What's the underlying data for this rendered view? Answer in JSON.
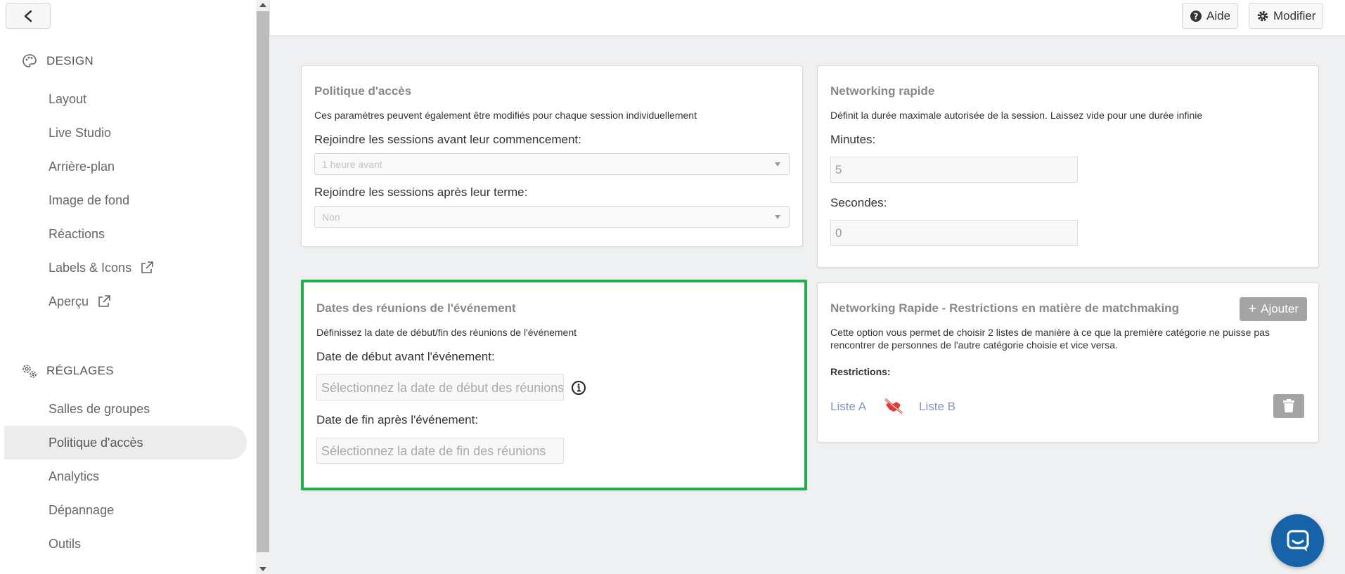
{
  "sidebar": {
    "back_label": "",
    "design": {
      "heading": "DESIGN",
      "items": [
        {
          "label": "Layout"
        },
        {
          "label": "Live Studio"
        },
        {
          "label": "Arrière-plan"
        },
        {
          "label": "Image de fond"
        },
        {
          "label": "Réactions"
        },
        {
          "label": "Labels & Icons",
          "icon": "external-link-icon"
        },
        {
          "label": "Aperçu",
          "icon": "external-link-icon"
        }
      ]
    },
    "settings": {
      "heading": "RÉGLAGES",
      "items": [
        {
          "label": "Salles de groupes"
        },
        {
          "label": "Politique d'accès",
          "active": true
        },
        {
          "label": "Analytics"
        },
        {
          "label": "Dépannage"
        },
        {
          "label": "Outils"
        }
      ]
    }
  },
  "topbar": {
    "help_label": "Aide",
    "edit_label": "Modifier"
  },
  "access_policy": {
    "title": "Politique d'accès",
    "description": "Ces paramètres peuvent également être modifiés pour chaque session individuellement",
    "join_before_label": "Rejoindre les sessions avant leur commencement:",
    "join_before_value": "1 heure avant",
    "join_after_label": "Rejoindre les sessions après leur terme:",
    "join_after_value": "Non"
  },
  "speed_networking": {
    "title": "Networking rapide",
    "description": "Définit la durée maximale autorisée de la session. Laissez vide pour une durée infinie",
    "minutes_label": "Minutes:",
    "minutes_value": "5",
    "seconds_label": "Secondes:",
    "seconds_value": "0"
  },
  "meeting_dates": {
    "title": "Dates des réunions de l'événement",
    "description": "Définissez la date de début/fin des réunions de l'événement",
    "start_label": "Date de début avant l'événement:",
    "start_placeholder": "Sélectionnez la date de début des réunions",
    "end_label": "Date de fin après l'événement:",
    "end_placeholder": "Sélectionnez la date de fin des réunions"
  },
  "matchmaking": {
    "title": "Networking Rapide - Restrictions en matière de matchmaking",
    "add_label": "Ajouter",
    "description_line1": "Cette option vous permet de choisir 2 listes de manière à ce que la première catégorie ne puisse pas",
    "description_line2": "rencontrer de personnes de l'autre catégorie choisie et vice versa.",
    "restrictions_label": "Restrictions:",
    "list_a": "Liste A",
    "list_b": "Liste B"
  },
  "colors": {
    "highlight": "#1fae4b",
    "link": "#7d95c8",
    "chat": "#1663a8",
    "restriction_icon": "#e03a3a"
  }
}
